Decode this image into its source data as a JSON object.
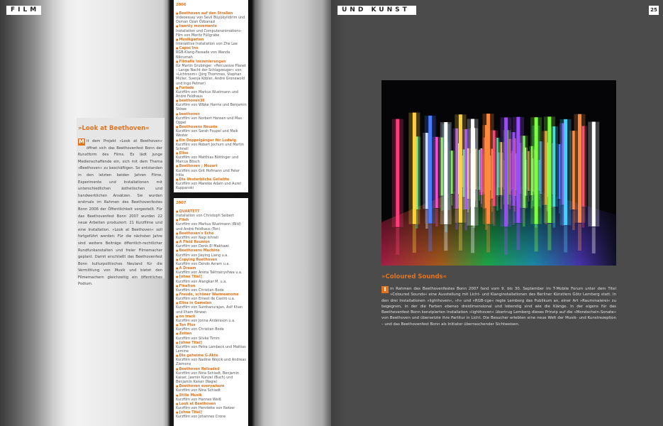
{
  "left": {
    "header": "FILM",
    "intro": {
      "title": "»Look at Beethoven«",
      "initial": "M",
      "body": "it dem Projekt »Look at Beethoven« öffnet sich das Beethovenfest Bonn der Kunstform des Films. Es lädt junge Medienschaffende ein, sich mit dem Thema »Beethoven« zu beschäftigen. So entstanden in den letzten beiden Jahren Filme, Experimente und Installationen mit unterschiedlichen ästhetischen und handwerklichen Ansätzen. Sie wurden erstmals im Rahmen des Beethovenfestes Bonn 2006 der Öffentlichkeit vorgestellt. Für das Beethovenfest Bonn 2007 wurden 22 neue Arbeiten produziert: 21 Kurzfilme und eine Installation. »Look at Beethoven« soll fortgeführt werden: Für die nächsten Jahre sind weitere Beiträge öffentlich-rechtlicher Rundfunkanstalten und freier Filmemacher geplant. Damit erschließt das Beethovenfest Bonn kulturpolitisches Neuland für die Vermittlung von Musik und bietet den Filmemachern gleichzeitig ein öffentliches Podium."
    },
    "list2006": {
      "year": "2006",
      "items": [
        {
          "title": "Beethoven auf den Straßen",
          "desc": "Videoessay von Sevil Büyükyildirim und Osman Ozan Özbanazi"
        },
        {
          "title": "twenty movements",
          "desc": "Installation und Computeranimations-Film von Moritz Füllgrabe"
        },
        {
          "title": "Musikgarten",
          "desc": "Interaktive Installation von Zhe Lee"
        },
        {
          "title": "Capoc'Inn",
          "desc": "RGB-Klang-Fassade von Wanda Nikrumah"
        },
        {
          "title": "Filmalle Inszenierungen",
          "desc": "für Martin Grubinger: »Percussive Planet – Lange Nacht der Schlagzeuger« von »Lichtroom« (Jörg Thommes, Stephan Müller, Svenja Köbler, André Gronewold und Ingo Pelmer)"
        },
        {
          "title": "Furiade",
          "desc": "Kurzfilm von Markus Wustmann und André Feldhaus"
        },
        {
          "title": "beethoven36",
          "desc": "Kurzfilm von Wibke Harms und Benjamin Stöwe"
        },
        {
          "title": "beethoven",
          "desc": "Kurzfilm von Norbert Hansen und Max Oppel"
        },
        {
          "title": "Beethovens Neunte",
          "desc": "Kurzfilm von Sarah Foupel und Maik Wester"
        },
        {
          "title": "Ein Doppelgänger für Ludwig",
          "desc": "Kurzfilm von Robert Jochum und Martin Schnell"
        },
        {
          "title": "Elise",
          "desc": "Kurzfilm von Matthias Böttinger und Marcus Bösch"
        },
        {
          "title": "Beethoven ; Mozart",
          "desc": "Kurzfilm von Grit Hofmann und Peter Iritla"
        },
        {
          "title": "Die Unsterbliche Geliebte",
          "desc": "Kurzfilm von Mareike Adam und Aurel Kuppanski"
        }
      ]
    },
    "list2007": {
      "year": "2007",
      "items": [
        {
          "title": "QUARTETT",
          "desc": "Installation von Christoph Seibert"
        },
        {
          "title": "Flieh",
          "desc": "Kurzfilm von Markus Wustmann (Bild) und André Feldhaus (Ton)"
        },
        {
          "title": "Beethoven's Echo",
          "desc": "Kurzfilm von Nagi Ishrati"
        },
        {
          "title": "A Field Reunion",
          "desc": "Kurzfilm von Denis El Makhawi"
        },
        {
          "title": "Beethovens Machine",
          "desc": "Kurzfilm von Jieying Liang u.a."
        },
        {
          "title": "Copying Beethoven",
          "desc": "Kurzfilm von Dendo Avram u.a."
        },
        {
          "title": "A Dream",
          "desc": "Kurzfilm von Aneta Taktrainyshwa u.a."
        },
        {
          "title": "[ohne Titel]",
          "desc": "Kurzfilm von Alangkar M. u.a."
        },
        {
          "title": "Finalton",
          "desc": "Kurzfilm von Christian Bode"
        },
        {
          "title": "Freude, schöner Warmeanome",
          "desc": "Kurzfilm von Ernest de Castro u.a."
        },
        {
          "title": "Elisa in Gamelan",
          "desc": "Kurzfilm von Sunthanurajan, Asif Khan und Ilham Nirwan"
        },
        {
          "title": "on track",
          "desc": "Kurzfilm von Jonna Andersson u.a."
        },
        {
          "title": "Ton Plus",
          "desc": "Kurzfilm von Christian Bode"
        },
        {
          "title": "Zeitan",
          "desc": "Kurzfilm von Silvke Timm"
        },
        {
          "title": "[ohne Titel]",
          "desc": "Kurzfilm von Petra Lambeck und Mattias Lemme"
        },
        {
          "title": "Die geheime G-Akte",
          "desc": "Kurzfilm von Nadine Wojcik und Andreas Ziemons"
        },
        {
          "title": "Beethoven Reloaded",
          "desc": "Kurzfilm von Nina Schiadt, Benjamin Kaiser, Jasmin Künzel (Buch) und Benjamin Kaiser (Regie)"
        },
        {
          "title": "Beethoven everywhere",
          "desc": "Kurzfilm von Nina Schiadt"
        },
        {
          "title": "Stille Musik",
          "desc": "Kurzfilm von Hannes Weiß"
        },
        {
          "title": "Look at Beethoven",
          "desc": "Kurzfilm von Henriette von Netzer"
        },
        {
          "title": "[ohne Titel]",
          "desc": "Kurzfilm von Johannes Crone"
        }
      ]
    }
  },
  "right": {
    "header": "UND KUNST",
    "page_number": "25",
    "title": "»Coloured Sounds«",
    "initial": "I",
    "body": "m Rahmen des Beethovenfestes Bonn 2007 fand vom 9. bis 30. September im T-Mobile Forum unter dem Titel »Coloured Sounds« eine Ausstellung mit Licht- und Klanginstallationen des Berliner Künstlers Götz Lemberg statt. In den drei Installationen »lighthoven«, »h« und »RGB-cge« regte Lemberg das Publikum an, einer Art »Raummalerei« zu begegnen, in der die Farben ebenso dreidimensional und lebendig sind wie die Klänge. In der eigens für das Beethovenfest Bonn konzipierten Installation »lighthoven« übertrug Lemberg dieses Prinzip auf die »Mondschein-Sonate« von Beethoven und übersetzte ihre Partitur in Licht. Die Besucher erlebten eine neue Welt der Musik- und Kunstrezeption – und das Beethovenfest Bonn als Initiator überraschender Sichtweisen."
  },
  "colors": {
    "accent": "#e2731e"
  },
  "icons": {
    "bullet": "square-bullet-icon"
  }
}
